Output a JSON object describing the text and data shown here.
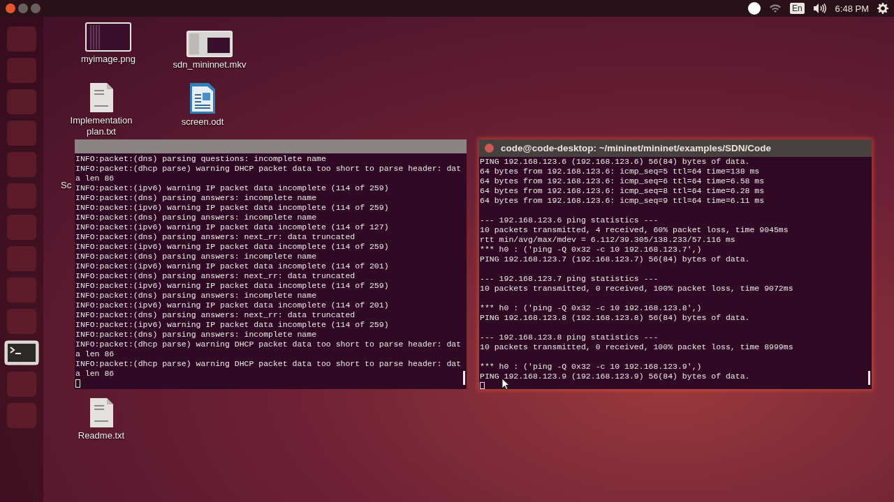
{
  "top_bar": {
    "keyboard_layout": "En",
    "clock": "6:48 PM"
  },
  "desktop_icons": [
    {
      "label": "myimage.png",
      "kind": "image"
    },
    {
      "label": "sdn_mininnet.mkv",
      "kind": "video"
    },
    {
      "label": "Implementation plan.txt",
      "kind": "text"
    },
    {
      "label": "screen.odt",
      "kind": "document"
    },
    {
      "label": "Sc",
      "kind": "hidden"
    },
    {
      "label": "Readme.txt",
      "kind": "text"
    }
  ],
  "terminals": [
    {
      "focused": false,
      "blocks": [
        [
          "INFO:packet:(dns) parsing questions: incomplete name",
          "INFO:packet:(dhcp parse) warning DHCP packet data too short to parse header: dat",
          "a len 86",
          "INFO:packet:(ipv6) warning IP packet data incomplete (114 of 259)",
          "INFO:packet:(dns) parsing answers: incomplete name",
          "INFO:packet:(ipv6) warning IP packet data incomplete (114 of 259)",
          "INFO:packet:(dns) parsing answers: incomplete name",
          "INFO:packet:(ipv6) warning IP packet data incomplete (114 of 127)",
          "INFO:packet:(dns) parsing answers: next_rr: data truncated",
          "INFO:packet:(ipv6) warning IP packet data incomplete (114 of 259)",
          "INFO:packet:(dns) parsing answers: incomplete name",
          "INFO:packet:(ipv6) warning IP packet data incomplete (114 of 201)",
          "INFO:packet:(dns) parsing answers: next_rr: data truncated",
          "INFO:packet:(ipv6) warning IP packet data incomplete (114 of 259)",
          "INFO:packet:(dns) parsing answers: incomplete name",
          "INFO:packet:(ipv6) warning IP packet data incomplete (114 of 201)",
          "INFO:packet:(dns) parsing answers: next_rr: data truncated",
          "INFO:packet:(ipv6) warning IP packet data incomplete (114 of 259)",
          "INFO:packet:(dns) parsing answers: incomplete name",
          "INFO:packet:(dhcp parse) warning DHCP packet data too short to parse header: dat",
          "a len 86",
          "INFO:packet:(dhcp parse) warning DHCP packet data too short to parse header: dat",
          "a len 86"
        ]
      ]
    },
    {
      "focused": true,
      "title": "code@code-desktop: ~/mininet/mininet/examples/SDN/Code",
      "blocks": [
        [
          "PING 192.168.123.6 (192.168.123.6) 56(84) bytes of data.",
          "64 bytes from 192.168.123.6: icmp_seq=5 ttl=64 time=138 ms",
          "64 bytes from 192.168.123.6: icmp_seq=6 ttl=64 time=6.58 ms",
          "64 bytes from 192.168.123.6: icmp_seq=8 ttl=64 time=6.28 ms",
          "64 bytes from 192.168.123.6: icmp_seq=9 ttl=64 time=6.11 ms"
        ],
        [
          "--- 192.168.123.6 ping statistics ---",
          "10 packets transmitted, 4 received, 60% packet loss, time 9045ms",
          "rtt min/avg/max/mdev = 6.112/39.305/138.233/57.116 ms",
          "*** h0 : ('ping -Q 0x32 -c 10 192.168.123.7',)",
          "PING 192.168.123.7 (192.168.123.7) 56(84) bytes of data."
        ],
        [
          "--- 192.168.123.7 ping statistics ---",
          "10 packets transmitted, 0 received, 100% packet loss, time 9072ms"
        ],
        [
          "*** h0 : ('ping -Q 0x32 -c 10 192.168.123.8',)",
          "PING 192.168.123.8 (192.168.123.8) 56(84) bytes of data."
        ],
        [
          "--- 192.168.123.8 ping statistics ---",
          "10 packets transmitted, 0 received, 100% packet loss, time 8999ms"
        ],
        [
          "*** h0 : ('ping -Q 0x32 -c 10 192.168.123.9',)",
          "PING 192.168.123.9 (192.168.123.9) 56(84) bytes of data."
        ]
      ]
    }
  ]
}
